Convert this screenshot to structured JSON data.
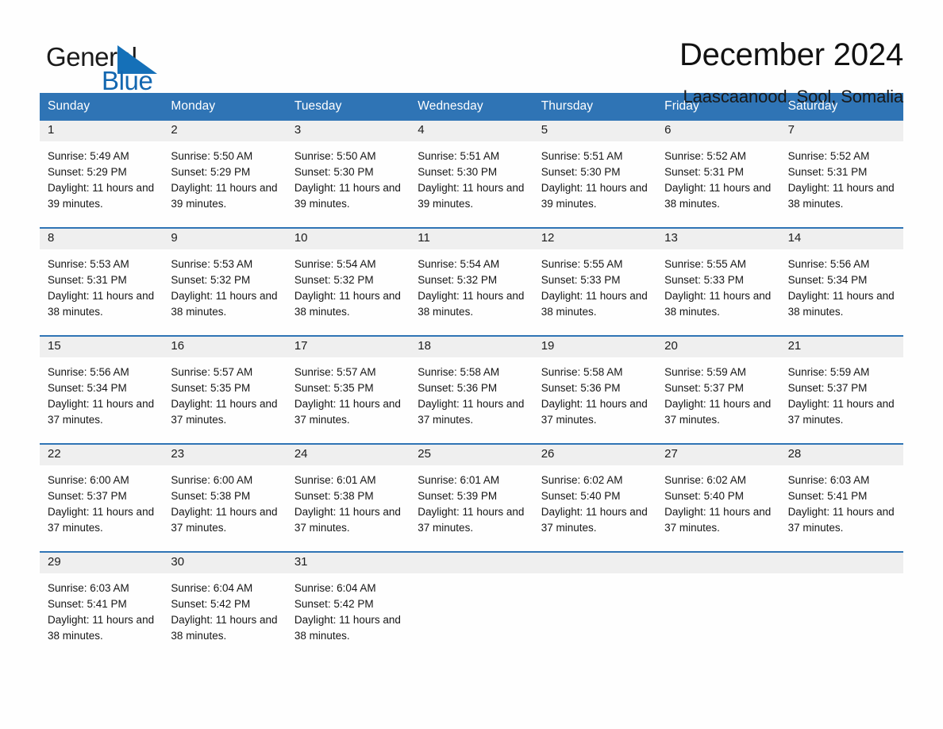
{
  "brand": {
    "word_one": "General",
    "word_two": "Blue",
    "triangle_icon": "triangle-logo-icon",
    "accent_color": "#1570b8"
  },
  "header": {
    "month_title": "December 2024",
    "location": "Laascaanood, Sool, Somalia"
  },
  "colors": {
    "header_blue": "#2f74b5",
    "daynum_band": "#efefef",
    "page_background": "#fefefe",
    "text": "#161616"
  },
  "calendar": {
    "weekdays": [
      "Sunday",
      "Monday",
      "Tuesday",
      "Wednesday",
      "Thursday",
      "Friday",
      "Saturday"
    ],
    "weeks": [
      [
        {
          "day": "1",
          "details": "Sunrise: 5:49 AM\nSunset: 5:29 PM\nDaylight: 11 hours and 39 minutes."
        },
        {
          "day": "2",
          "details": "Sunrise: 5:50 AM\nSunset: 5:29 PM\nDaylight: 11 hours and 39 minutes."
        },
        {
          "day": "3",
          "details": "Sunrise: 5:50 AM\nSunset: 5:30 PM\nDaylight: 11 hours and 39 minutes."
        },
        {
          "day": "4",
          "details": "Sunrise: 5:51 AM\nSunset: 5:30 PM\nDaylight: 11 hours and 39 minutes."
        },
        {
          "day": "5",
          "details": "Sunrise: 5:51 AM\nSunset: 5:30 PM\nDaylight: 11 hours and 39 minutes."
        },
        {
          "day": "6",
          "details": "Sunrise: 5:52 AM\nSunset: 5:31 PM\nDaylight: 11 hours and 38 minutes."
        },
        {
          "day": "7",
          "details": "Sunrise: 5:52 AM\nSunset: 5:31 PM\nDaylight: 11 hours and 38 minutes."
        }
      ],
      [
        {
          "day": "8",
          "details": "Sunrise: 5:53 AM\nSunset: 5:31 PM\nDaylight: 11 hours and 38 minutes."
        },
        {
          "day": "9",
          "details": "Sunrise: 5:53 AM\nSunset: 5:32 PM\nDaylight: 11 hours and 38 minutes."
        },
        {
          "day": "10",
          "details": "Sunrise: 5:54 AM\nSunset: 5:32 PM\nDaylight: 11 hours and 38 minutes."
        },
        {
          "day": "11",
          "details": "Sunrise: 5:54 AM\nSunset: 5:32 PM\nDaylight: 11 hours and 38 minutes."
        },
        {
          "day": "12",
          "details": "Sunrise: 5:55 AM\nSunset: 5:33 PM\nDaylight: 11 hours and 38 minutes."
        },
        {
          "day": "13",
          "details": "Sunrise: 5:55 AM\nSunset: 5:33 PM\nDaylight: 11 hours and 38 minutes."
        },
        {
          "day": "14",
          "details": "Sunrise: 5:56 AM\nSunset: 5:34 PM\nDaylight: 11 hours and 38 minutes."
        }
      ],
      [
        {
          "day": "15",
          "details": "Sunrise: 5:56 AM\nSunset: 5:34 PM\nDaylight: 11 hours and 37 minutes."
        },
        {
          "day": "16",
          "details": "Sunrise: 5:57 AM\nSunset: 5:35 PM\nDaylight: 11 hours and 37 minutes."
        },
        {
          "day": "17",
          "details": "Sunrise: 5:57 AM\nSunset: 5:35 PM\nDaylight: 11 hours and 37 minutes."
        },
        {
          "day": "18",
          "details": "Sunrise: 5:58 AM\nSunset: 5:36 PM\nDaylight: 11 hours and 37 minutes."
        },
        {
          "day": "19",
          "details": "Sunrise: 5:58 AM\nSunset: 5:36 PM\nDaylight: 11 hours and 37 minutes."
        },
        {
          "day": "20",
          "details": "Sunrise: 5:59 AM\nSunset: 5:37 PM\nDaylight: 11 hours and 37 minutes."
        },
        {
          "day": "21",
          "details": "Sunrise: 5:59 AM\nSunset: 5:37 PM\nDaylight: 11 hours and 37 minutes."
        }
      ],
      [
        {
          "day": "22",
          "details": "Sunrise: 6:00 AM\nSunset: 5:37 PM\nDaylight: 11 hours and 37 minutes."
        },
        {
          "day": "23",
          "details": "Sunrise: 6:00 AM\nSunset: 5:38 PM\nDaylight: 11 hours and 37 minutes."
        },
        {
          "day": "24",
          "details": "Sunrise: 6:01 AM\nSunset: 5:38 PM\nDaylight: 11 hours and 37 minutes."
        },
        {
          "day": "25",
          "details": "Sunrise: 6:01 AM\nSunset: 5:39 PM\nDaylight: 11 hours and 37 minutes."
        },
        {
          "day": "26",
          "details": "Sunrise: 6:02 AM\nSunset: 5:40 PM\nDaylight: 11 hours and 37 minutes."
        },
        {
          "day": "27",
          "details": "Sunrise: 6:02 AM\nSunset: 5:40 PM\nDaylight: 11 hours and 37 minutes."
        },
        {
          "day": "28",
          "details": "Sunrise: 6:03 AM\nSunset: 5:41 PM\nDaylight: 11 hours and 37 minutes."
        }
      ],
      [
        {
          "day": "29",
          "details": "Sunrise: 6:03 AM\nSunset: 5:41 PM\nDaylight: 11 hours and 38 minutes."
        },
        {
          "day": "30",
          "details": "Sunrise: 6:04 AM\nSunset: 5:42 PM\nDaylight: 11 hours and 38 minutes."
        },
        {
          "day": "31",
          "details": "Sunrise: 6:04 AM\nSunset: 5:42 PM\nDaylight: 11 hours and 38 minutes."
        },
        {
          "day": "",
          "details": ""
        },
        {
          "day": "",
          "details": ""
        },
        {
          "day": "",
          "details": ""
        },
        {
          "day": "",
          "details": ""
        }
      ]
    ]
  }
}
